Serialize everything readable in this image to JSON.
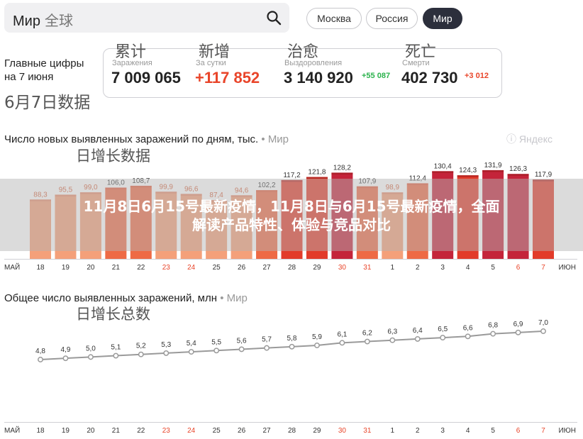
{
  "search": {
    "label": "Мир",
    "hint": "全球"
  },
  "region_tabs": [
    {
      "label": "Москва",
      "active": false
    },
    {
      "label": "Россия",
      "active": false
    },
    {
      "label": "Мир",
      "active": true
    }
  ],
  "header": {
    "title_line1": "Главные цифры",
    "title_line2": "на 7 июня",
    "cn_date": "6月7日数据"
  },
  "stats": [
    {
      "cn": "累计",
      "label": "Заражения",
      "value": "7 009 065",
      "increment": "",
      "value_color": "#222222"
    },
    {
      "cn": "新增",
      "label": "За сутки",
      "value": "+117 852",
      "increment": "",
      "value_color": "#e9452a"
    },
    {
      "cn": "治愈",
      "label": "Выздоровления",
      "value": "3 140 920",
      "increment": "+55 087",
      "value_color": "#222222"
    },
    {
      "cn": "死亡",
      "label": "Смерти",
      "value": "402 730",
      "increment": "+3 012",
      "value_color": "#222222"
    }
  ],
  "logo_text": "Яндекс",
  "banner": {
    "line1": "11月8日6月15号最新疫情，11月8日与6月15号最新疫情，全面",
    "line2": "解读产品特性、体验与竞品对比"
  },
  "chart_data": [
    {
      "type": "bar",
      "title": "Число новых выявленных заражений по дням, тыс.",
      "source": "Мир",
      "cn_title": "日增长数据",
      "categories": [
        "18",
        "19",
        "20",
        "21",
        "22",
        "23",
        "24",
        "25",
        "26",
        "27",
        "28",
        "29",
        "30",
        "31",
        "1",
        "2",
        "3",
        "4",
        "5",
        "6",
        "7"
      ],
      "month_start": "МАЙ",
      "month_end": "ИЮН",
      "weekend_indices": [
        5,
        6,
        12,
        13,
        19,
        20
      ],
      "values": [
        88.3,
        95.5,
        99.0,
        106.0,
        108.7,
        99.9,
        96.6,
        87.4,
        94.6,
        102.2,
        117.2,
        121.8,
        128.2,
        107.9,
        98.9,
        112.4,
        130.4,
        124.3,
        131.9,
        126.3,
        117.9
      ],
      "labels": [
        "88,3",
        "95,5",
        "99,0",
        "106,0",
        "108,7",
        "99,9",
        "96,6",
        "87,4",
        "94,6",
        "102,2",
        "117,2",
        "121,8",
        "128,2",
        "107,9",
        "98,9",
        "112,4",
        "130,4",
        "124,3",
        "131,9",
        "126,3",
        "117,9"
      ],
      "ylim": [
        0,
        135
      ]
    },
    {
      "type": "line",
      "title": "Общее число выявленных заражений, млн",
      "source": "Мир",
      "cn_title": "日增长总数",
      "categories": [
        "18",
        "19",
        "20",
        "21",
        "22",
        "23",
        "24",
        "25",
        "26",
        "27",
        "28",
        "29",
        "30",
        "31",
        "1",
        "2",
        "3",
        "4",
        "5",
        "6",
        "7"
      ],
      "month_start": "МАЙ",
      "month_end": "ИЮН",
      "weekend_indices": [
        5,
        6,
        12,
        13,
        19,
        20
      ],
      "values": [
        4.8,
        4.9,
        5.0,
        5.1,
        5.2,
        5.3,
        5.4,
        5.5,
        5.6,
        5.7,
        5.8,
        5.9,
        6.1,
        6.2,
        6.3,
        6.4,
        6.5,
        6.6,
        6.8,
        6.9,
        7.0
      ],
      "labels": [
        "4,8",
        "4,9",
        "5,0",
        "5,1",
        "5,2",
        "5,3",
        "5,4",
        "5,5",
        "5,6",
        "5,7",
        "5,8",
        "5,9",
        "6,1",
        "6,2",
        "6,3",
        "6,4",
        "6,5",
        "6,6",
        "6,8",
        "6,9",
        "7,0"
      ],
      "ylim": [
        4.8,
        7.0
      ]
    }
  ],
  "colors": {
    "bar_light": "#f4a07a",
    "bar_mid": "#ee6a45",
    "bar_red": "#e23b2a",
    "bar_dark": "#c4243a",
    "line": "#9a9a9a",
    "weekend": "#e9452a",
    "axis_text": "#333333"
  }
}
